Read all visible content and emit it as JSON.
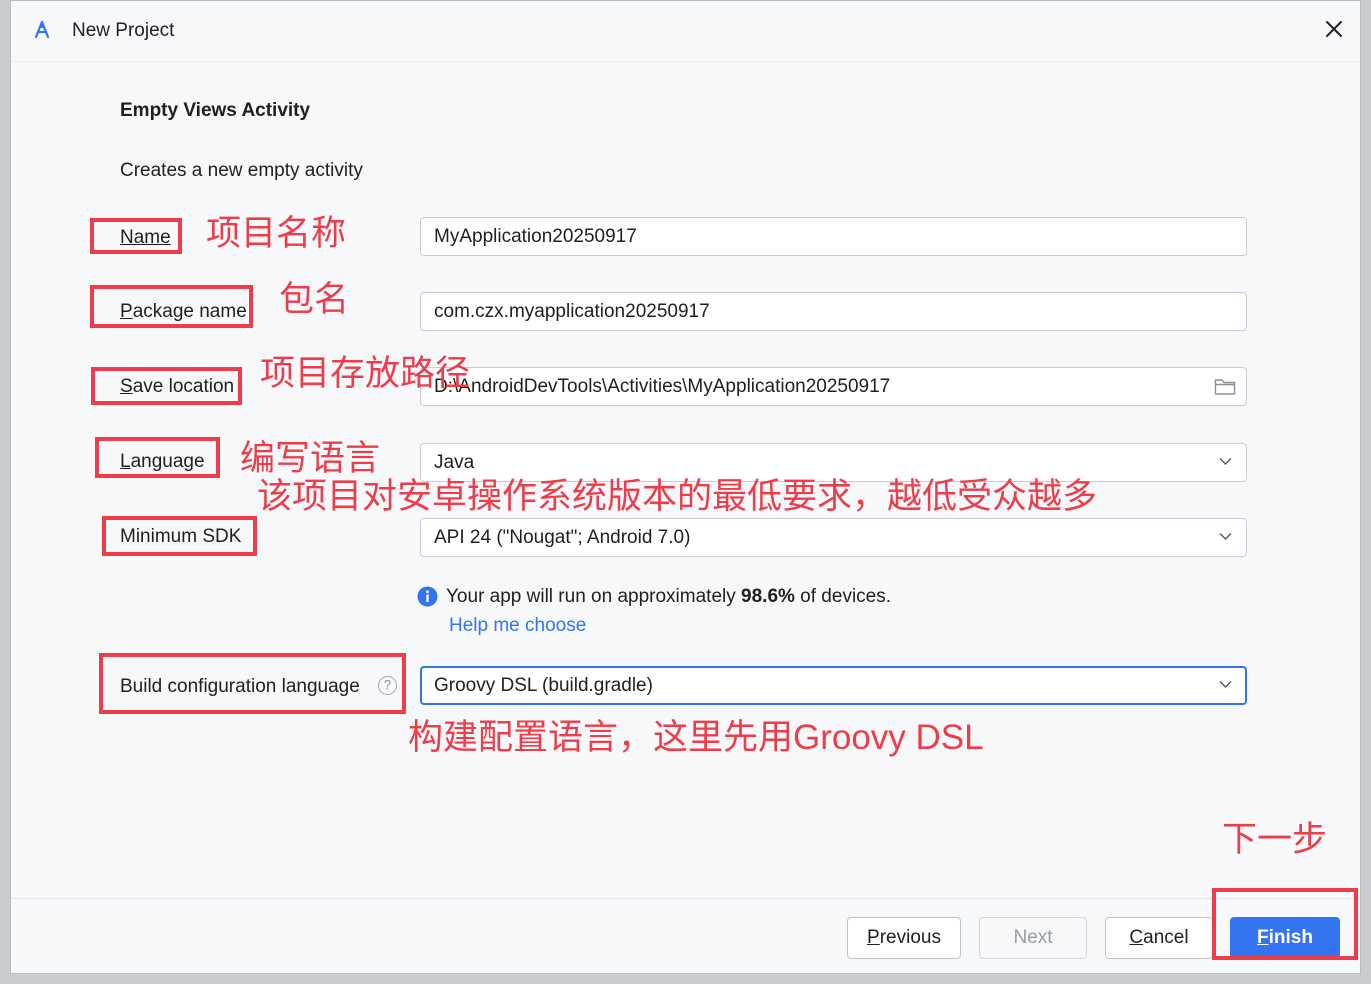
{
  "window": {
    "title": "New Project"
  },
  "template": {
    "heading": "Empty Views Activity",
    "description": "Creates a new empty activity"
  },
  "form": {
    "name": {
      "label_mnemonic": "N",
      "label_rest": "ame",
      "value": "MyApplication20250917"
    },
    "package": {
      "label_mnemonic": "P",
      "label_rest": "ackage name",
      "value": "com.czx.myapplication20250917"
    },
    "save_location": {
      "label_mnemonic": "S",
      "label_rest": "ave location",
      "value": "D:\\AndroidDevTools\\Activities\\MyApplication20250917"
    },
    "language": {
      "label_mnemonic": "L",
      "label_rest": "anguage",
      "value": "Java"
    },
    "min_sdk": {
      "label": "Minimum SDK",
      "value": "API 24 (\"Nougat\"; Android 7.0)"
    },
    "build_config": {
      "label": "Build configuration language",
      "value": "Groovy DSL (build.gradle)",
      "help_mark": "?"
    }
  },
  "info": {
    "prefix": "Your app will run on approximately ",
    "percent": "98.6%",
    "suffix": " of devices.",
    "help_link": "Help me choose"
  },
  "buttons": {
    "previous": {
      "mnemonic": "P",
      "rest": "revious"
    },
    "next": "Next",
    "cancel": {
      "mnemonic": "C",
      "rest": "ancel"
    },
    "finish": {
      "mnemonic": "F",
      "rest": "inish"
    }
  },
  "annotations": {
    "name_note": "项目名称",
    "package_note": "包名",
    "location_note": "项目存放路径",
    "language_note": "编写语言",
    "sdk_note": "该项目对安卓操作系统版本的最低要求，越低受众越多",
    "build_note": "构建配置语言，这里先用Groovy DSL",
    "finish_note": "下一步"
  },
  "colors": {
    "accent": "#3574f0",
    "annotation": "#ee3d4a"
  },
  "icons": {
    "app": "android-studio-icon",
    "close": "close-icon",
    "folder": "folder-icon",
    "info": "info-icon",
    "dropdown": "chevron-down-icon"
  }
}
